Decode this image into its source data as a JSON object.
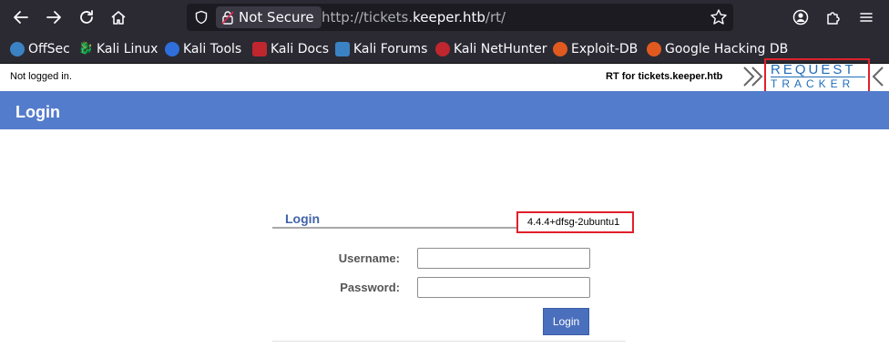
{
  "browser": {
    "security_label": "Not Secure",
    "url_prefix": "http://tickets.",
    "url_host": "keeper.htb",
    "url_suffix": "/rt/",
    "bookmarks": [
      {
        "label": "OffSec",
        "color": "#3b82c4"
      },
      {
        "label": "Kali Linux",
        "color": "#2b2a33"
      },
      {
        "label": "Kali Tools",
        "color": "#2f6fdb"
      },
      {
        "label": "Kali Docs",
        "color": "#c0262e"
      },
      {
        "label": "Kali Forums",
        "color": "#3b82c4"
      },
      {
        "label": "Kali NetHunter",
        "color": "#c0262e"
      },
      {
        "label": "Exploit-DB",
        "color": "#e05a1f"
      },
      {
        "label": "Google Hacking DB",
        "color": "#e05a1f"
      }
    ]
  },
  "rt": {
    "session_status": "Not logged in.",
    "instance_label": "RT for tickets.keeper.htb",
    "logo_line1": "REQUEST",
    "logo_line2": "TRACKER",
    "page_title": "Login",
    "login_heading": "Login",
    "version": "4.4.4+dfsg-2ubuntu1",
    "username_label": "Username:",
    "password_label": "Password:",
    "username_value": "",
    "password_value": "",
    "submit_label": "Login"
  },
  "colors": {
    "title_bar": "#547ccc",
    "highlight": "#e0202a",
    "logo_blue": "#1f6db7",
    "button": "#4a6fbd"
  }
}
